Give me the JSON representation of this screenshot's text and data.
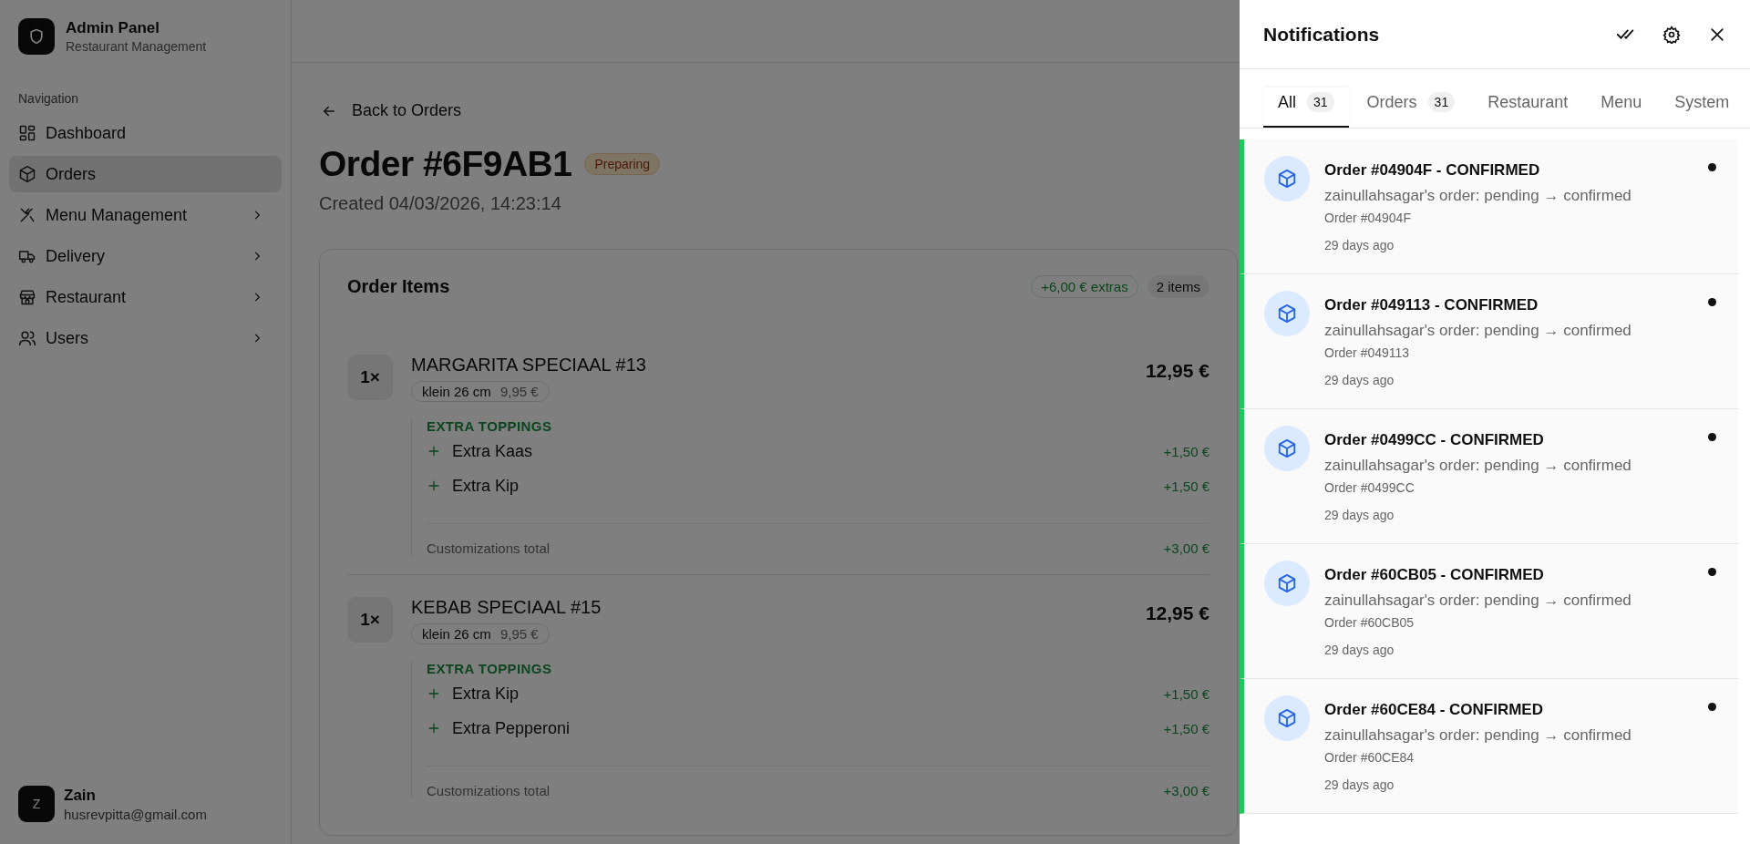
{
  "sidebar": {
    "app_title": "Admin Panel",
    "app_subtitle": "Restaurant Management",
    "section_label": "Navigation",
    "items": [
      {
        "label": "Dashboard",
        "selected": false,
        "has_submenu": false
      },
      {
        "label": "Orders",
        "selected": true,
        "has_submenu": false
      },
      {
        "label": "Menu Management",
        "selected": false,
        "has_submenu": true
      },
      {
        "label": "Delivery",
        "selected": false,
        "has_submenu": true
      },
      {
        "label": "Restaurant",
        "selected": false,
        "has_submenu": true
      },
      {
        "label": "Users",
        "selected": false,
        "has_submenu": true
      }
    ],
    "user": {
      "initial": "Z",
      "name": "Zain",
      "email": "husrevpitta@gmail.com"
    }
  },
  "order": {
    "back_link": "Back to Orders",
    "title": "Order #6F9AB1",
    "status": "Preparing",
    "created": "Created 04/03/2026, 14:23:14",
    "card": {
      "title": "Order Items",
      "extras_badge": "+6,00 € extras",
      "count_badge": "2 items",
      "items": [
        {
          "qty": "1×",
          "name": "MARGARITA SPECIAAL #13",
          "size": "klein 26 cm",
          "size_price": "9,95 €",
          "price": "12,95 €",
          "group_title": "EXTRA TOPPINGS",
          "extras": [
            {
              "name": "Extra Kaas",
              "price": "+1,50 €"
            },
            {
              "name": "Extra Kip",
              "price": "+1,50 €"
            }
          ],
          "total_label": "Customizations total",
          "total": "+3,00 €"
        },
        {
          "qty": "1×",
          "name": "KEBAB SPECIAAL #15",
          "size": "klein 26 cm",
          "size_price": "9,95 €",
          "price": "12,95 €",
          "group_title": "EXTRA TOPPINGS",
          "extras": [
            {
              "name": "Extra Kip",
              "price": "+1,50 €"
            },
            {
              "name": "Extra Pepperoni",
              "price": "+1,50 €"
            }
          ],
          "total_label": "Customizations total",
          "total": "+3,00 €"
        }
      ]
    }
  },
  "notifications": {
    "title": "Notifications",
    "tabs": [
      {
        "label": "All",
        "count": "31",
        "selected": true
      },
      {
        "label": "Orders",
        "count": "31",
        "selected": false
      },
      {
        "label": "Restaurant",
        "selected": false
      },
      {
        "label": "Menu",
        "selected": false
      },
      {
        "label": "System",
        "selected": false
      }
    ],
    "items": [
      {
        "title": "Order #04904F - CONFIRMED",
        "message": "zainullahsagar's order: pending → confirmed",
        "reference": "Order #04904F",
        "time": "29 days ago",
        "unread": true
      },
      {
        "title": "Order #049113 - CONFIRMED",
        "message": "zainullahsagar's order: pending → confirmed",
        "reference": "Order #049113",
        "time": "29 days ago",
        "unread": true
      },
      {
        "title": "Order #0499CC - CONFIRMED",
        "message": "zainullahsagar's order: pending → confirmed",
        "reference": "Order #0499CC",
        "time": "29 days ago",
        "unread": true
      },
      {
        "title": "Order #60CB05 - CONFIRMED",
        "message": "zainullahsagar's order: pending → confirmed",
        "reference": "Order #60CB05",
        "time": "29 days ago",
        "unread": true
      },
      {
        "title": "Order #60CE84 - CONFIRMED",
        "message": "zainullahsagar's order: pending → confirmed",
        "reference": "Order #60CE84",
        "time": "29 days ago",
        "unread": true
      }
    ]
  }
}
